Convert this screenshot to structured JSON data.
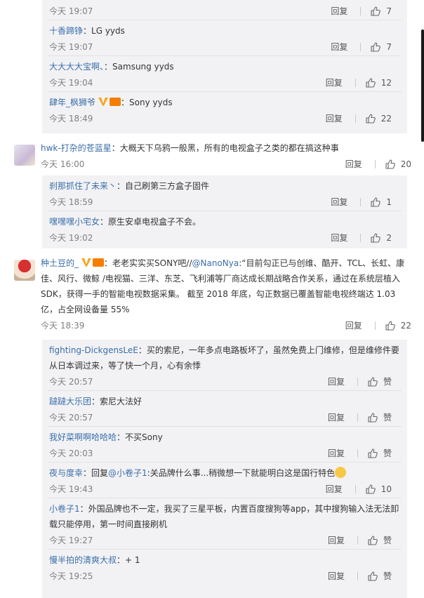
{
  "r0": {
    "time": "今天 19:07",
    "reply": "回复",
    "likes": "7"
  },
  "r1": {
    "user": "十香蹄铮",
    "sep": "：",
    "text": "LG yyds",
    "time": "今天 19:07",
    "reply": "回复",
    "likes": "7"
  },
  "r2": {
    "user": "大大大大宝啊、",
    "sep": "：",
    "text": "Samsung yyds",
    "time": "今天 19:04",
    "reply": "回复",
    "likes": "12"
  },
  "r3": {
    "user": "肆年_枫狮爷",
    "sep": "：",
    "text": "Sony yyds",
    "time": "今天 18:49",
    "reply": "回复",
    "likes": "22"
  },
  "c1": {
    "user": "hwk-打杂的苍蓝星",
    "sep": "：",
    "text": "大概天下乌鸦一般黑，所有的电视盒子之类的都在搞这种事",
    "time": "今天 16:00",
    "reply": "回复",
    "likes": "20"
  },
  "c1r1": {
    "user": "刹那抓住了未来丶",
    "sep": "：",
    "text": "自己刷第三方盒子固件",
    "time": "今天 18:59",
    "reply": "回复",
    "likes": "1"
  },
  "c1r2": {
    "user": "嘿嘿嘿小宅女",
    "sep": "：",
    "text": "原生安卓电视盒子不会。",
    "time": "今天 19:02",
    "reply": "回复",
    "likes": "2"
  },
  "c2": {
    "user": "种土豆的_",
    "sep": "：",
    "text1": "老老实实买SONY吧//",
    "mention": "@NanoNya",
    "text1b": ":“目前勾正已与创维、酷开、TCL、长虹、康",
    "text2": "佳、风行、微鲸 /电视猫、三洋、东芝、飞利浦等厂商达成长期战略合作关系，通过在系统层植入",
    "text3": "SDK，获得一手的智能电视数据采集。 截至 2018 年底，勾正数据已覆盖智能电视终端达 1.03",
    "text4": "亿，占全网设备量 55%",
    "time": "今天 18:39",
    "reply": "回复",
    "likes": "22"
  },
  "c2r1": {
    "user": "fighting-DickgensLeE",
    "sep": "：",
    "text1": "买的索尼，一年多点电路板坏了，虽然免费上门维修，但是维修件要",
    "text2": "从日本调过来，等了快一个月，心有余悸",
    "time": "今天 20:57",
    "reply": "回复",
    "likes": "赞"
  },
  "c2r2": {
    "user": "躂躂大乐团",
    "sep": "：",
    "text": "索尼大法好",
    "time": "今天 20:57",
    "reply": "回复",
    "likes": "赞"
  },
  "c2r3": {
    "user": "我好菜啊啊哈哈哈",
    "sep": "：",
    "text": "不买Sony",
    "time": "今天 20:03",
    "reply": "回复",
    "likes": "赞"
  },
  "c2r4": {
    "user": "夜与度幸",
    "sep": "：",
    "pre": "回复",
    "mention": "@小卷子1",
    "text": ":关品牌什么事...稍微想一下就能明白这是国行特色",
    "time": "今天 19:43",
    "reply": "回复",
    "likes": "10"
  },
  "c2r5": {
    "user": "小卷子1",
    "sep": "：",
    "text1": "外国品牌也不一定，我买了三星平板，内置百度搜狗等app，其中搜狗输入法无法卸",
    "text2": "载只能停用，第一时间直接刷机",
    "time": "今天 19:27",
    "reply": "回复",
    "likes": "赞"
  },
  "c2r6": {
    "user": "慢半拍的清爽大叔",
    "sep": "：",
    "text": "+ 1",
    "time": "今天 19:25",
    "reply": "回复",
    "likes": "赞"
  },
  "icons": {
    "like": "thumb-up-icon",
    "verified": "v-badge-icon",
    "crown": "crown-icon",
    "emoji": "sweat-smile-emoji"
  }
}
